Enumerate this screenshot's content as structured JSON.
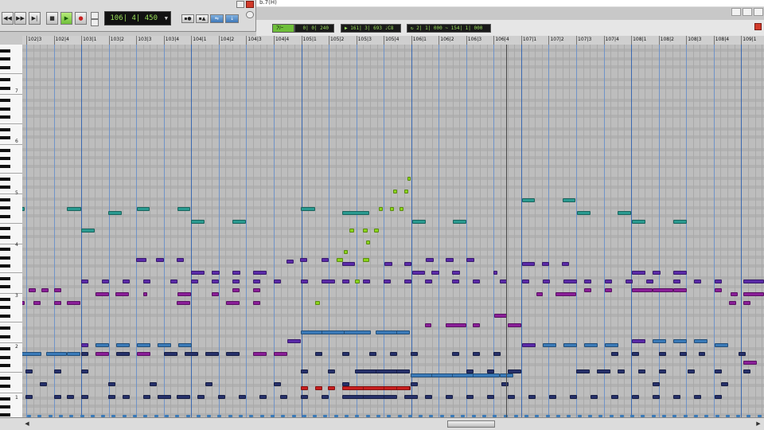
{
  "window": {
    "title_fragment": "b.7(H)"
  },
  "transport": {
    "counter": "106| 4| 450",
    "buttons": [
      "rewind",
      "fast-forward",
      "go-to-end",
      "stop",
      "play",
      "record"
    ],
    "glyphs": {
      "rewind": "◀◀",
      "ffwd": "▶▶",
      "end": "▶|",
      "stop": "■",
      "play": "▶",
      "rec": "●"
    }
  },
  "toolbar": {
    "tool_mode": "ﾌﾘｰ",
    "snap_value": "0| 0| 240",
    "cursor_position": "161| 3| 693",
    "cursor_note": "C8",
    "range_start": "2| 1| 000",
    "range_sep": "~",
    "range_end": "154| 1| 000"
  },
  "ruler": {
    "labels": [
      "102|3",
      "102|4",
      "103|1",
      "103|2",
      "103|3",
      "103|4",
      "104|1",
      "104|2",
      "104|3",
      "104|4",
      "105|1",
      "105|2",
      "105|3",
      "105|4",
      "106|1",
      "106|2",
      "106|3",
      "106|4",
      "107|1",
      "107|2",
      "107|3",
      "107|4",
      "108|1",
      "108|2",
      "108|3",
      "108|4",
      "109|1"
    ]
  },
  "keyboard": {
    "octave_labels": [
      "7",
      "6",
      "5",
      "4",
      "3",
      "2",
      "1"
    ]
  },
  "colors": {
    "teal": "#2a9a90",
    "purple": "#5a2aa8",
    "magenta": "#8a1e98",
    "navy": "#26306a",
    "blue": "#3a7ab8",
    "lime": "#8ad41a",
    "red": "#c81e1e",
    "grid_bg": "#bdbdbd",
    "lcd_text": "#9be05a"
  }
}
